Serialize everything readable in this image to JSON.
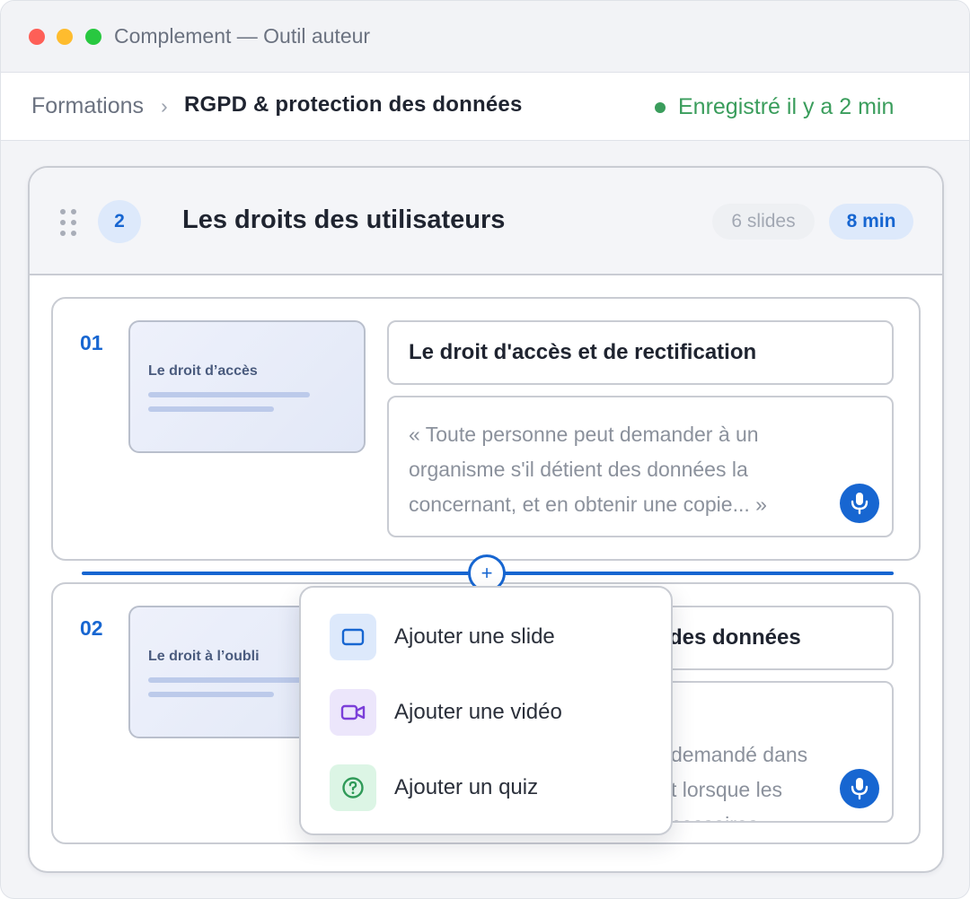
{
  "window": {
    "title": "Complement — Outil auteur"
  },
  "breadcrumb": {
    "root": "Formations",
    "separator": "›",
    "current": "RGPD & protection des données"
  },
  "save_status": {
    "text": "Enregistré il y a 2 min",
    "color": "#3a9d5c"
  },
  "module": {
    "number": "2",
    "title": "Les droits des utilisateurs",
    "slides_count": "6 slides",
    "duration": "8 min"
  },
  "slides": [
    {
      "index": "01",
      "thumb_title": "Le droit d’accès",
      "title": "Le droit d'accès et de rectification",
      "narration": "« Toute personne peut demander à un organisme s'il détient des données la concernant, et en obtenir une copie... »"
    },
    {
      "index": "02",
      "thumb_title": "Le droit à l’oubli",
      "title": "des données",
      "narration": "demandé dans\nt lorsque les\ncessaires... »"
    }
  ],
  "insert_menu": {
    "button_symbol": "+",
    "items": [
      {
        "label": "Ajouter une slide",
        "icon": "slide-icon"
      },
      {
        "label": "Ajouter une vidéo",
        "icon": "video-icon"
      },
      {
        "label": "Ajouter un quiz",
        "icon": "quiz-icon"
      }
    ]
  },
  "colors": {
    "accent": "#1766d1",
    "success": "#3a9d5c"
  }
}
